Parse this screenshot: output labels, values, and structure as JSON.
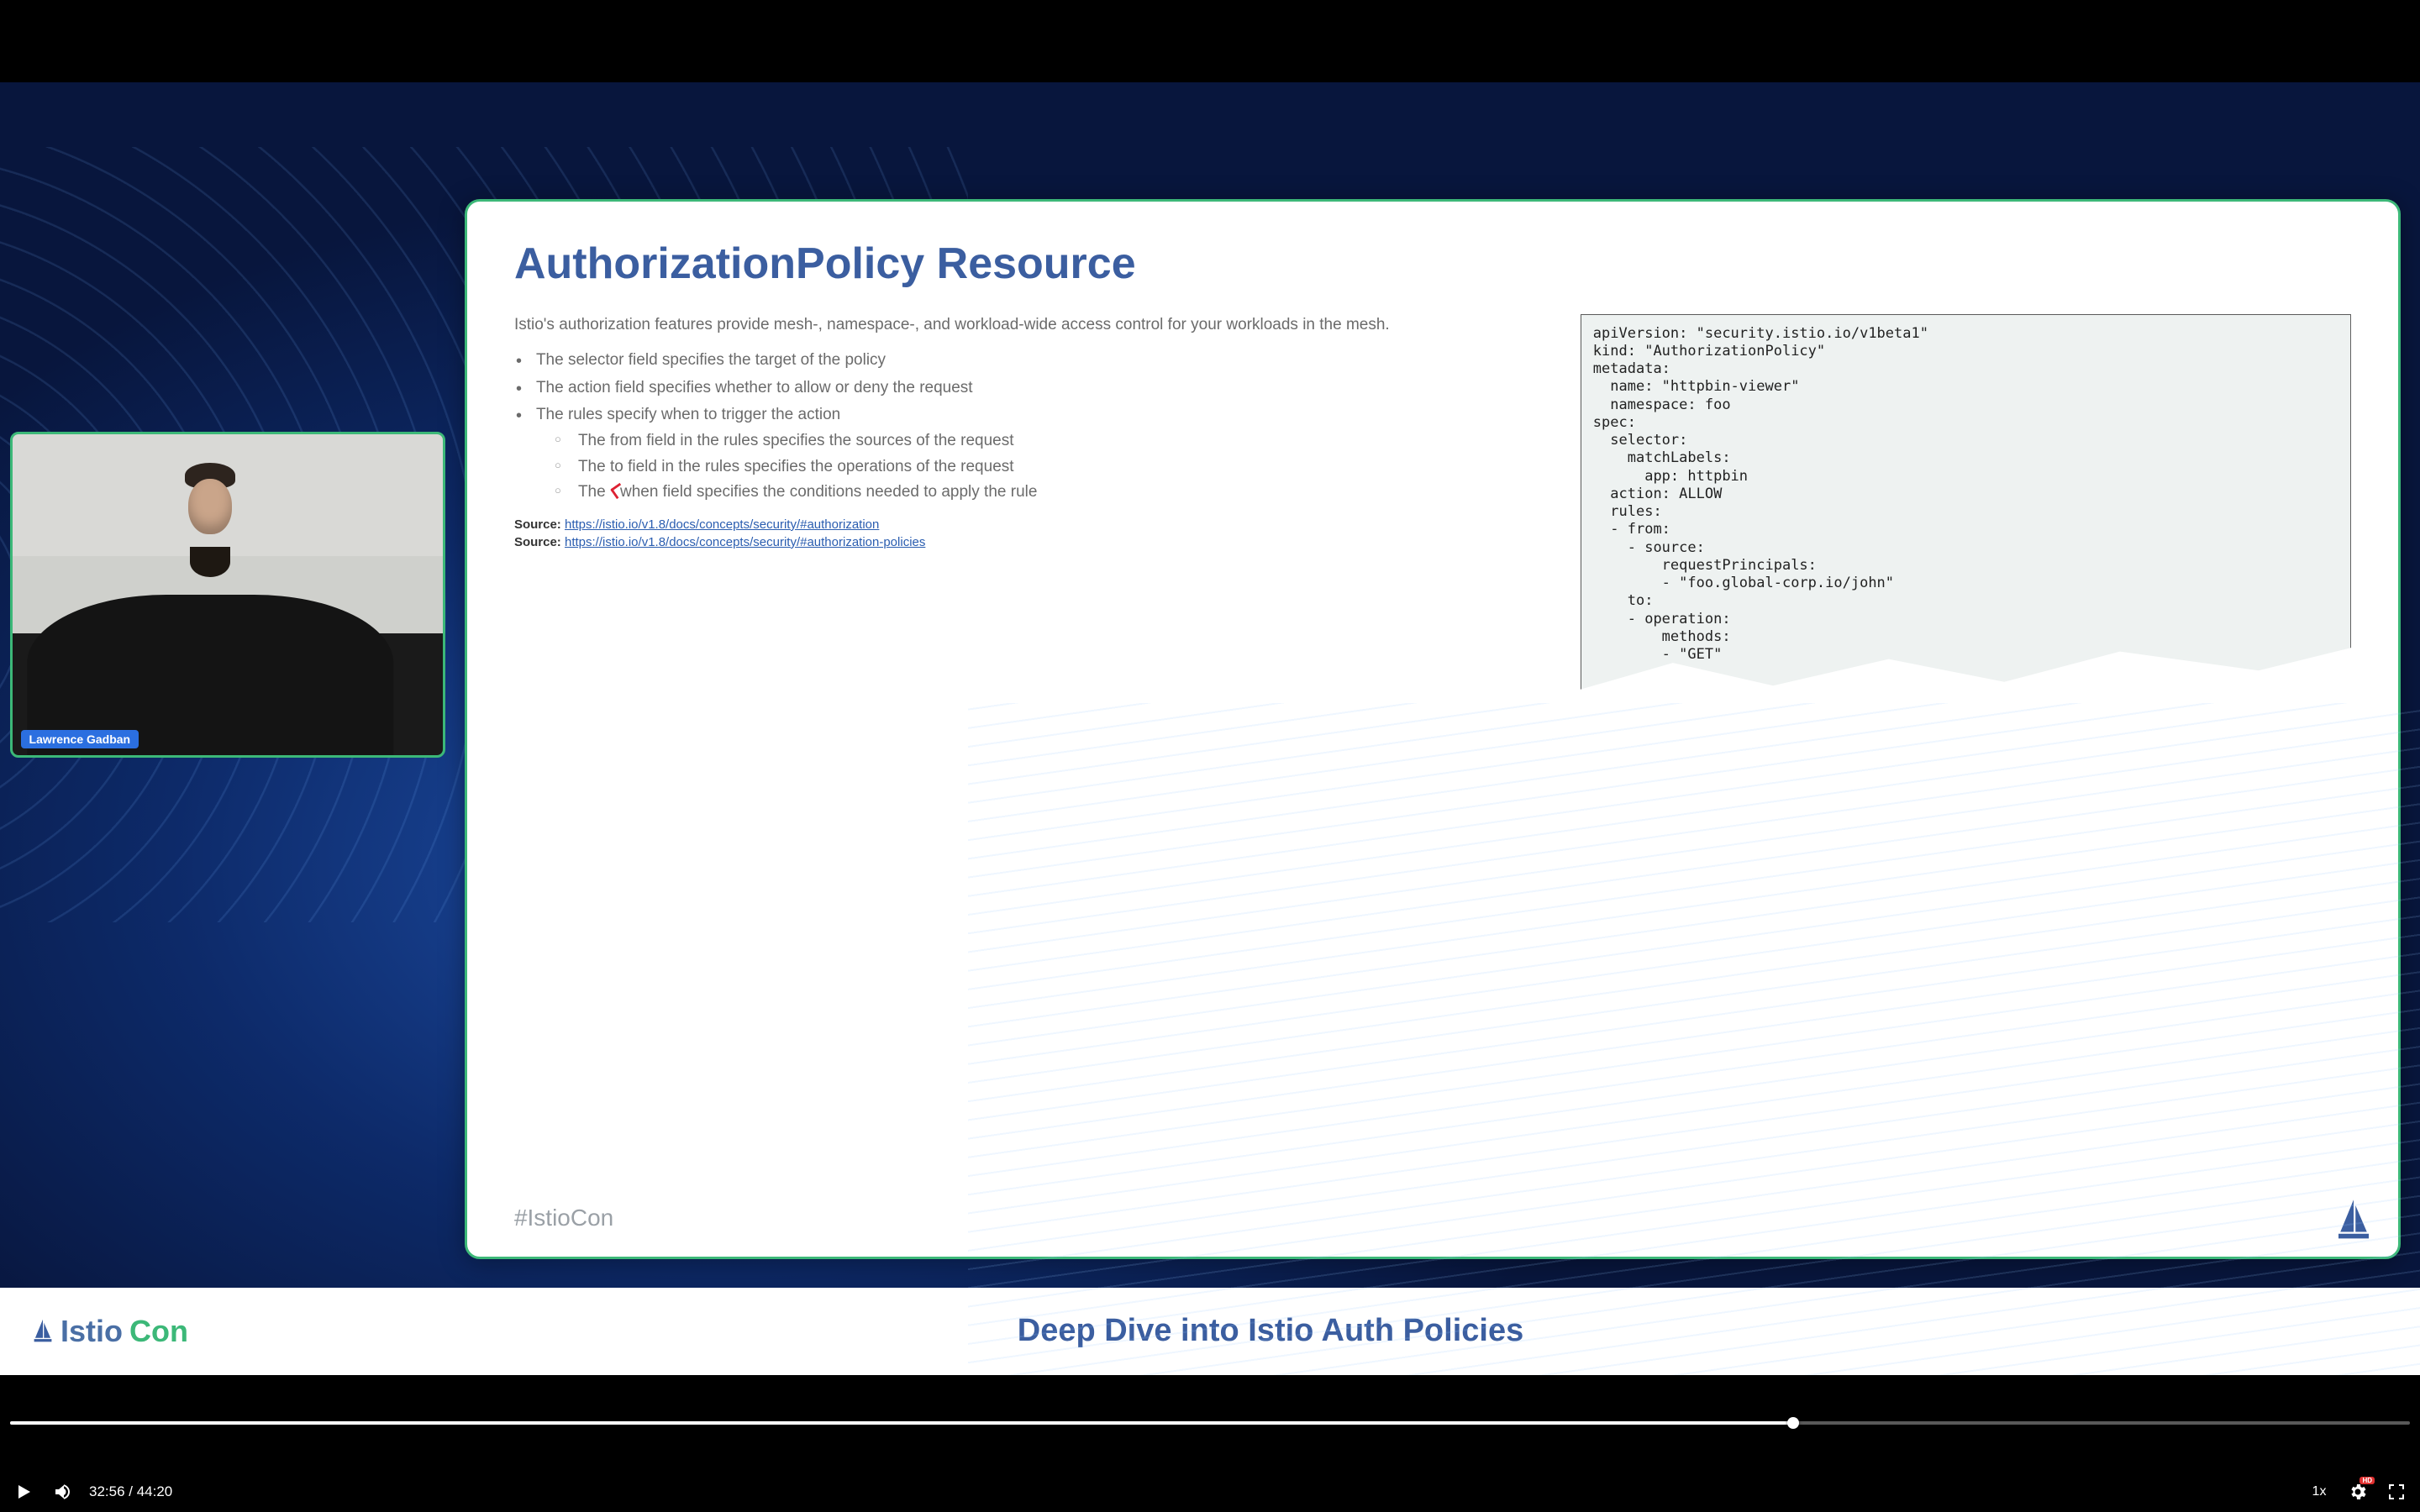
{
  "player": {
    "current_time": "32:56",
    "duration": "44:20",
    "progress_pct": 74.3,
    "speed_label": "1x",
    "quality_badge": "HD"
  },
  "speaker": {
    "name": "Lawrence Gadban"
  },
  "lower_third": {
    "brand_istio": "Istio",
    "brand_con": "Con",
    "talk_title": "Deep Dive into Istio Auth Policies"
  },
  "slide": {
    "title": "AuthorizationPolicy Resource",
    "intro": "Istio's authorization features provide mesh-, namespace-, and workload-wide access control for your workloads in the mesh.",
    "bullets": {
      "b1": "The selector field specifies the target of the policy",
      "b2": "The action field specifies whether to allow or deny the request",
      "b3": "The rules specify when to trigger the action",
      "s1": "The from field in the rules specifies the sources of the request",
      "s2": "The to field in the rules specifies the operations of the request",
      "s3_pre": "The ",
      "s3_post": "when field specifies the conditions needed to apply the rule"
    },
    "source_label": "Source:",
    "source1_url": "https://istio.io/v1.8/docs/concepts/security/#authorization",
    "source2_url": "https://istio.io/v1.8/docs/concepts/security/#authorization-policies",
    "hashtag": "#IstioCon",
    "code": "apiVersion: \"security.istio.io/v1beta1\"\nkind: \"AuthorizationPolicy\"\nmetadata:\n  name: \"httpbin-viewer\"\n  namespace: foo\nspec:\n  selector:\n    matchLabels:\n      app: httpbin\n  action: ALLOW\n  rules:\n  - from:\n    - source:\n        requestPrincipals:\n        - \"foo.global-corp.io/john\"\n    to:\n    - operation:\n        methods:\n        - \"GET\""
  }
}
